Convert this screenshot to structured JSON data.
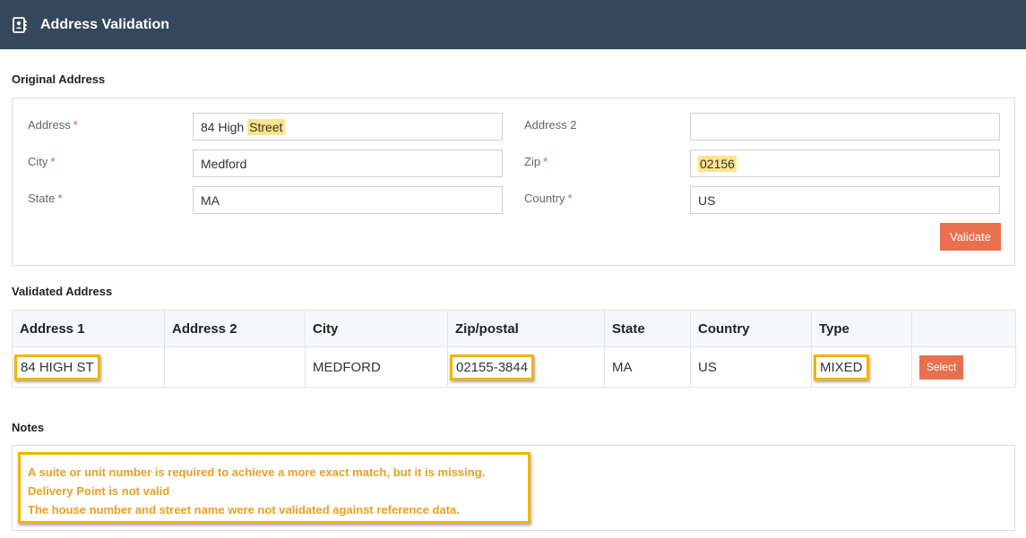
{
  "header": {
    "title": "Address Validation",
    "icon": "address-book-icon"
  },
  "original": {
    "heading": "Original Address",
    "address_label": "Address",
    "address_value_plain": "84 High ",
    "address_value_highlight": "Street",
    "address2_label": "Address 2",
    "address2_value": "",
    "city_label": "City",
    "city_value": "Medford",
    "zip_label": "Zip",
    "zip_value": "02156",
    "state_label": "State",
    "state_value": "MA",
    "country_label": "Country",
    "country_value": "US",
    "required_mark": "*",
    "validate_label": "Validate"
  },
  "validated": {
    "heading": "Validated Address",
    "columns": [
      "Address 1",
      "Address 2",
      "City",
      "Zip/postal",
      "State",
      "Country",
      "Type",
      ""
    ],
    "row": {
      "address1": "84 HIGH ST",
      "address2": "",
      "city": "MEDFORD",
      "zip": "02155-3844",
      "state": "MA",
      "country": "US",
      "type": "MIXED",
      "select_label": "Select"
    }
  },
  "notes": {
    "heading": "Notes",
    "lines": [
      "A suite or unit number is required to achieve a more exact match, but it is missing.",
      "Delivery Point is not valid",
      "The house number and street name were not validated against reference data."
    ]
  },
  "colors": {
    "header_bg": "#35475c",
    "accent_button": "#e8704f",
    "highlight": "#fde48a",
    "callout_border": "#f3b400",
    "note_text": "#e8a020",
    "required": "#d9534f"
  }
}
